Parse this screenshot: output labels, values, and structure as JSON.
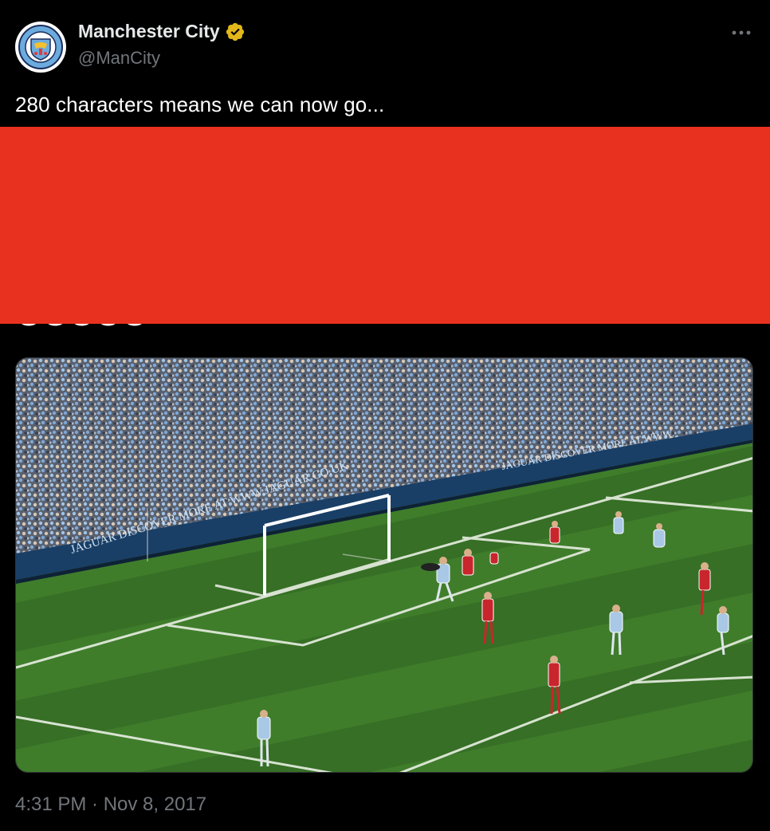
{
  "author": {
    "display_name": "Manchester City",
    "handle": "@ManCity",
    "avatar_icon": "manchester-city-crest",
    "verified_icon": "verified-gold-badge"
  },
  "tweet": {
    "text": "280 characters means we can now go...",
    "hidden_line": "OOOOO",
    "timestamp": "4:31 PM · Nov 8, 2017"
  },
  "media": {
    "type": "video-still",
    "board_text_1": "JAGUAR  DISCOVER MORE AT WWW.JAGUAR.CO.UK",
    "board_text_2": "JAGUAR  DISCOVER MORE AT  WWW."
  },
  "colors": {
    "background": "#000000",
    "redaction": "#e8321f",
    "verified_gold": "#e2b719",
    "handle_gray": "#71767b",
    "pitch": "#3e7a2a"
  }
}
